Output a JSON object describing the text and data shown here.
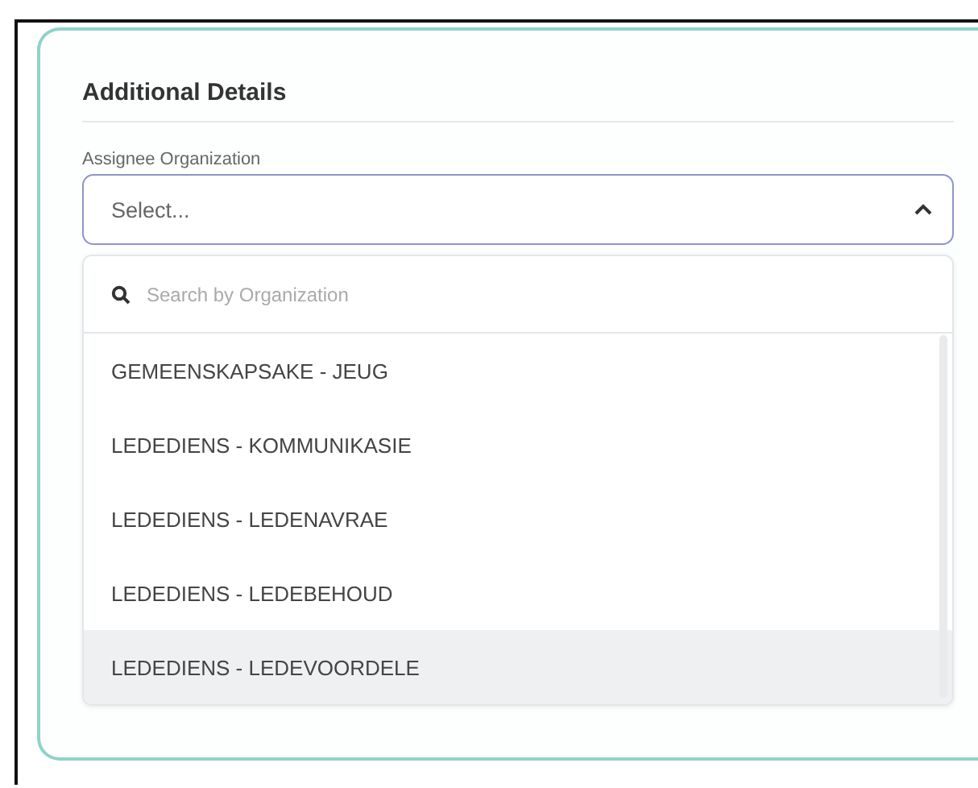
{
  "section": {
    "title": "Additional Details"
  },
  "field": {
    "label": "Assignee Organization",
    "placeholder": "Select...",
    "expanded": true
  },
  "search": {
    "placeholder": "Search by Organization"
  },
  "options": [
    {
      "label": "GEMEENSKAPSAKE - JEUG",
      "highlighted": false
    },
    {
      "label": "LEDEDIENS - KOMMUNIKASIE",
      "highlighted": false
    },
    {
      "label": "LEDEDIENS - LEDENAVRAE",
      "highlighted": false
    },
    {
      "label": "LEDEDIENS - LEDEBEHOUD",
      "highlighted": false
    },
    {
      "label": "LEDEDIENS - LEDEVOORDELE",
      "highlighted": true
    }
  ]
}
